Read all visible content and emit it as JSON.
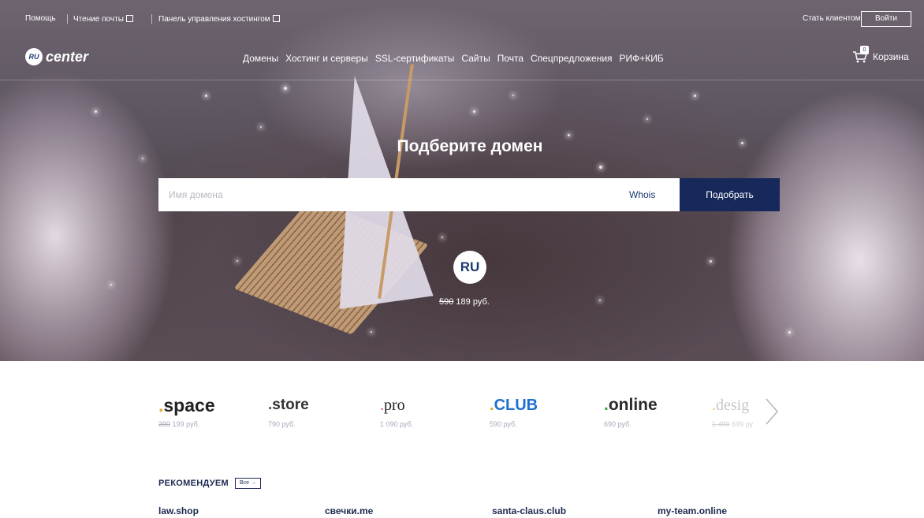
{
  "topbar": {
    "help": "Помощь",
    "mail": "Чтение почты",
    "hosting_panel": "Панель управления хостингом",
    "become_client": "Стать клиентом",
    "login": "Войти"
  },
  "logo": {
    "badge": "RU",
    "text": "center"
  },
  "nav": [
    "Домены",
    "Хостинг и серверы",
    "SSL-сертификаты",
    "Сайты",
    "Почта",
    "Спецпредложения",
    "РИФ+КИБ"
  ],
  "cart": {
    "label": "Корзина",
    "count": "0"
  },
  "hero": {
    "title": "Подберите домен",
    "search_placeholder": "Имя домена",
    "whois": "Whois",
    "pick_button": "Подобрать",
    "ru_badge": "RU",
    "ru_old_price": "590",
    "ru_price": "189 руб."
  },
  "tlds": [
    {
      "dot": ".",
      "name": "space",
      "old": "390",
      "price": "199 руб.",
      "style": "sans"
    },
    {
      "dot": ".",
      "name": "store",
      "old": "",
      "price": "790 руб.",
      "style": "sans"
    },
    {
      "dot": ".",
      "name": "pro",
      "old": "",
      "price": "1 090 руб.",
      "style": "serif"
    },
    {
      "dot": ".",
      "name": "CLUB",
      "old": "",
      "price": "590 руб.",
      "style": "club"
    },
    {
      "dot": ".",
      "name": "online",
      "old": "",
      "price": "690 руб.",
      "style": "sans"
    },
    {
      "dot": ".",
      "name": "desig",
      "old": "1 490",
      "price": "699 ру",
      "style": "faded"
    }
  ],
  "recommend": {
    "title": "РЕКОМЕНДУЕМ",
    "all": "Все →",
    "domains": [
      "law.shop",
      "свечки.me",
      "santa-claus.club",
      "my-team.online"
    ]
  },
  "colors": {
    "brand_navy": "#17295a",
    "tld_dot": "#e4a41c",
    "club_blue": "#1f6fd0"
  }
}
